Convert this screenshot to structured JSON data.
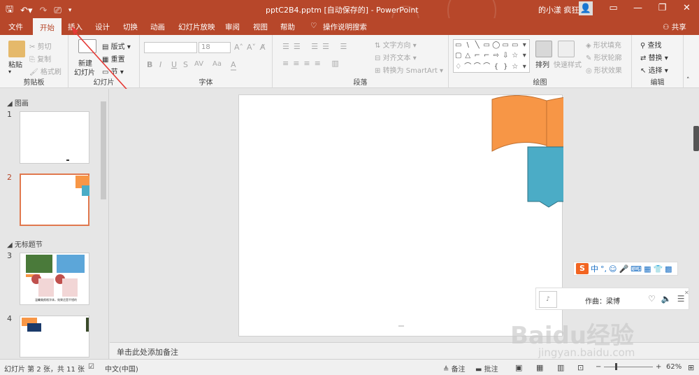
{
  "titlebar": {
    "title": "pptC2B4.pptm [自动保存的]  -  PowerPoint",
    "user": "的小漾 疯狂",
    "qat": [
      "save-icon",
      "undo-icon",
      "redo-icon",
      "present-icon",
      "customize-icon"
    ],
    "window_buttons": [
      "▭",
      "—",
      "❐",
      "✕"
    ]
  },
  "tabs": {
    "items": [
      "文件",
      "开始",
      "插入",
      "设计",
      "切换",
      "动画",
      "幻灯片放映",
      "审阅",
      "视图",
      "帮助",
      "操作说明搜索"
    ],
    "active": "开始",
    "share": "共享"
  },
  "ribbon": {
    "clipboard": {
      "label": "剪贴板",
      "paste": "粘贴",
      "cut": "剪切",
      "copy": "复制",
      "format_painter": "格式刷"
    },
    "slides": {
      "label": "幻灯片",
      "new_slide": "新建",
      "new_slide2": "幻灯片",
      "layout": "版式",
      "reset": "重置",
      "section": "节"
    },
    "font": {
      "label": "字体",
      "font_name": "",
      "font_size": "18",
      "buttons": [
        "B",
        "I",
        "U",
        "S",
        "AV",
        "Aa",
        "A"
      ]
    },
    "paragraph": {
      "label": "段落",
      "text_direction": "文字方向",
      "align_text": "对齐文本",
      "smartart": "转换为 SmartArt"
    },
    "drawing": {
      "label": "绘图",
      "arrange": "排列",
      "quick_styles": "快速样式",
      "fill": "形状填充",
      "outline": "形状轮廓",
      "effects": "形状效果"
    },
    "editing": {
      "label": "编辑",
      "find": "查找",
      "replace": "替换",
      "select": "选择"
    }
  },
  "thumbpane": {
    "section1": "图画",
    "section2": "无标题节",
    "slides": [
      {
        "num": "1",
        "caption": ""
      },
      {
        "num": "2",
        "caption": ""
      },
      {
        "num": "3",
        "caption": "温馨美颜格字体，效果还是不错的"
      },
      {
        "num": "4",
        "caption": ""
      }
    ]
  },
  "notes": {
    "placeholder": "单击此处添加备注"
  },
  "status": {
    "slide_info": "幻灯片 第 2 张，共 11 张",
    "language": "中文(中国)",
    "notes": "备注",
    "comments": "批注",
    "zoom": "62%"
  },
  "music": {
    "title": "作曲：梁博"
  },
  "watermark": {
    "text": "Baidu经验",
    "url": "jingyan.baidu.com"
  },
  "colors": {
    "accent": "#b7472a",
    "orange": "#f79646",
    "teal": "#4bacc6"
  }
}
